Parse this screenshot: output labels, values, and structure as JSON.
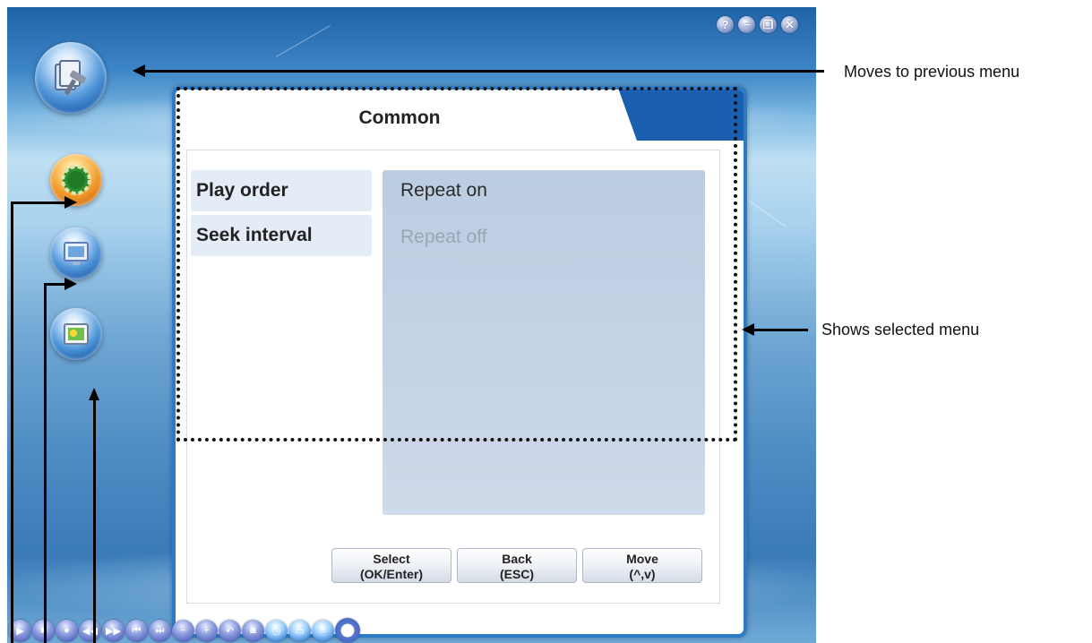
{
  "window": {
    "controls": [
      {
        "name": "help-button",
        "glyph": "?"
      },
      {
        "name": "minimize-button",
        "glyph": "−"
      },
      {
        "name": "restore-button",
        "glyph": "❐"
      },
      {
        "name": "close-button",
        "glyph": "✕"
      }
    ]
  },
  "sidebar": {
    "items": [
      {
        "name": "previous-menu-button",
        "icon": "folder-hammer-icon"
      },
      {
        "name": "settings-menu-button",
        "icon": "gear-icon"
      },
      {
        "name": "display-menu-button",
        "icon": "monitor-icon"
      },
      {
        "name": "photo-menu-button",
        "icon": "photo-folder-icon"
      }
    ]
  },
  "panel": {
    "title": "Common",
    "options": [
      {
        "label": "Play order"
      },
      {
        "label": "Seek interval"
      }
    ],
    "values": [
      {
        "label": "Repeat on",
        "state": "selected"
      },
      {
        "label": "Repeat off",
        "state": "inactive"
      }
    ],
    "buttons": [
      {
        "line1": "Select",
        "line2": "(OK/Enter)"
      },
      {
        "line1": "Back",
        "line2": "(ESC)"
      },
      {
        "line1": "Move",
        "line2": "(^,v)"
      }
    ]
  },
  "toolbar": {
    "icons": [
      "play-icon",
      "stop-icon",
      "record-icon",
      "rewind-icon",
      "fast-forward-icon",
      "previous-icon",
      "next-icon",
      "volume-down-icon",
      "volume-up-icon",
      "back-icon",
      "camera-icon",
      "clock-icon",
      "folder-icon",
      "subtitle-icon",
      "menu-icon"
    ]
  },
  "annotations": {
    "previous_menu": "Moves to previous menu",
    "selected_menu": "Shows selected menu"
  },
  "colors": {
    "panel_border": "#2d7ac6",
    "header_tab": "#1b5fb0",
    "value_box": "#c5d3e5"
  }
}
